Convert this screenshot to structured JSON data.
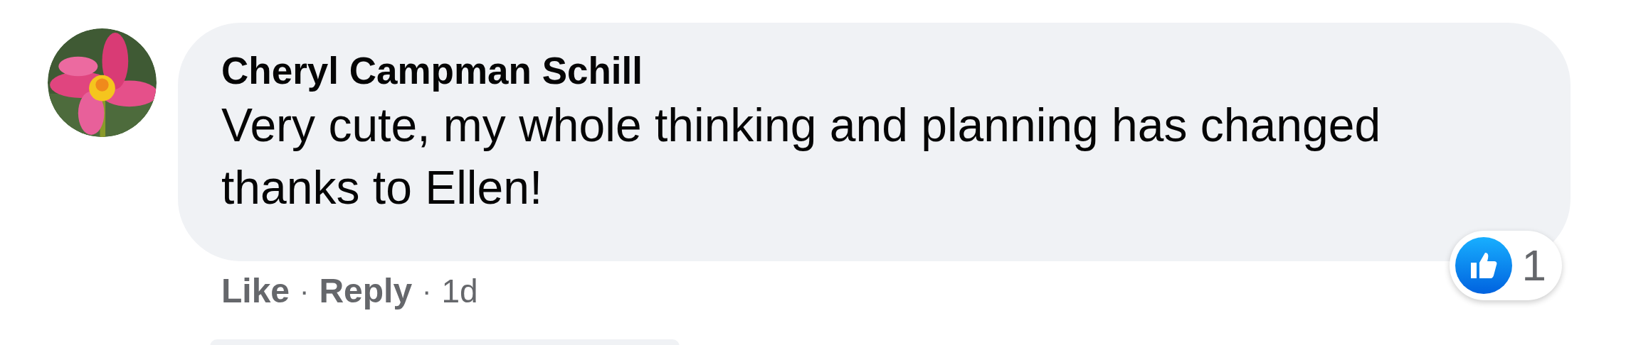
{
  "comment": {
    "author": "Cheryl Campman Schill",
    "text": "Very cute, my whole thinking and planning has changed thanks to Ellen!",
    "reaction_count": "1",
    "footer": [
      {
        "kind": "action",
        "text": "Like"
      },
      {
        "kind": "separator",
        "text": "·"
      },
      {
        "kind": "action",
        "text": "Reply"
      },
      {
        "kind": "separator",
        "text": "·"
      },
      {
        "kind": "time",
        "text": "1d"
      }
    ]
  }
}
